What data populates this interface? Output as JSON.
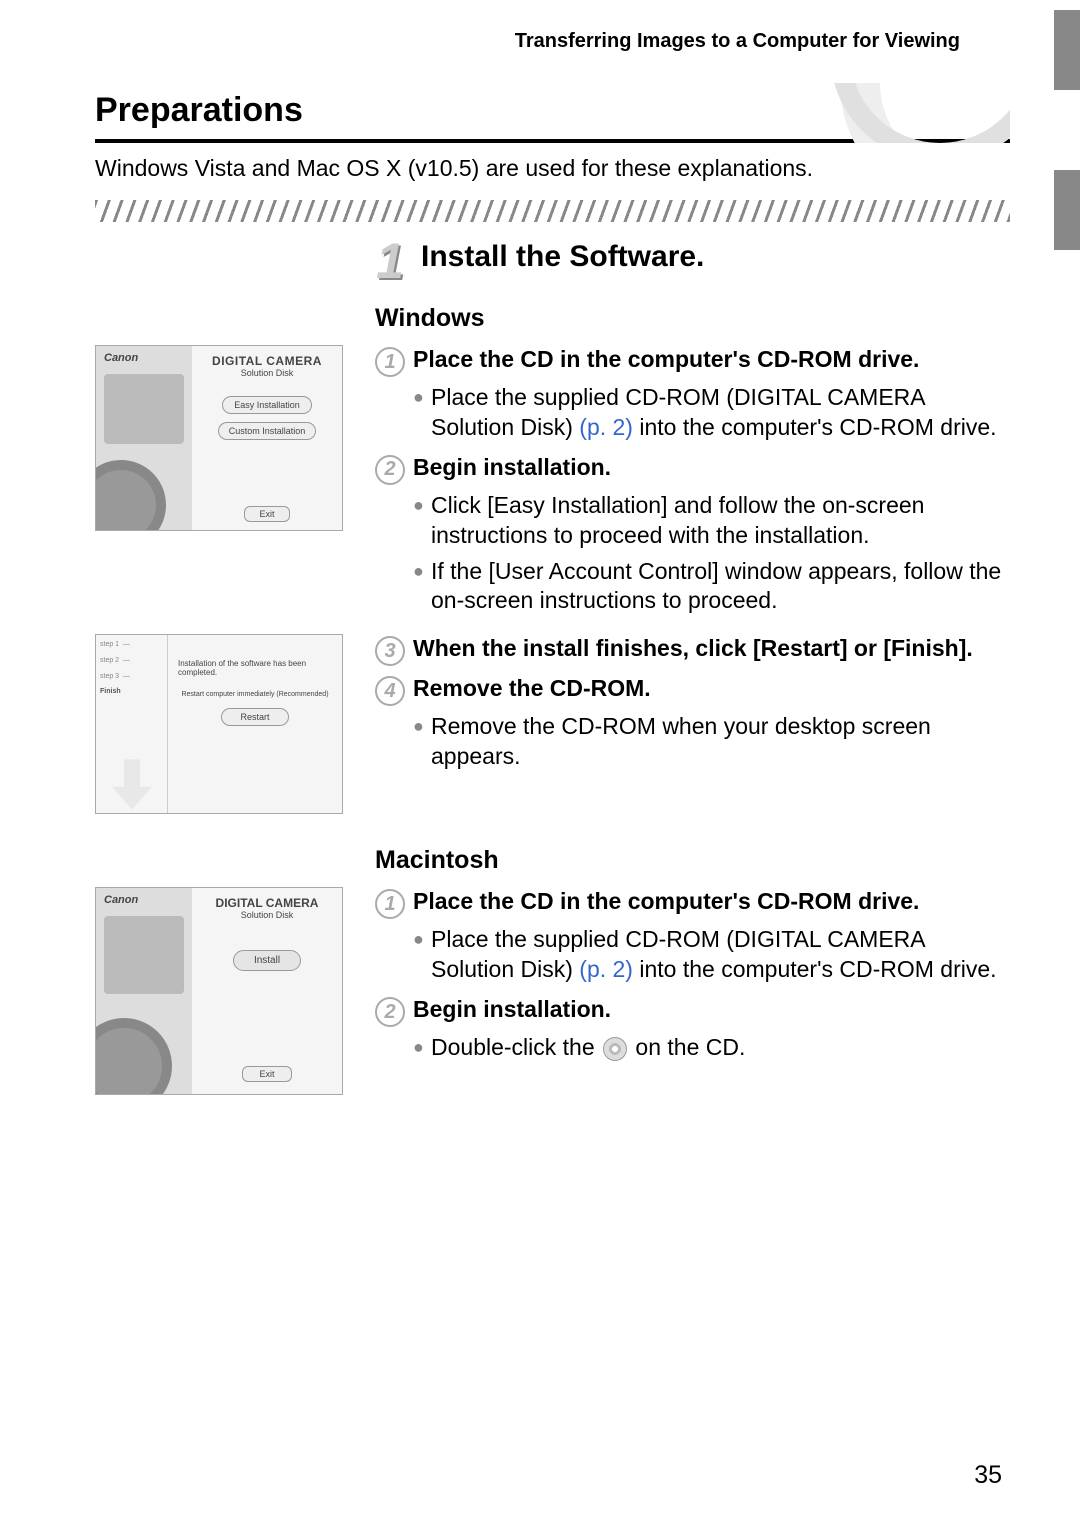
{
  "header": "Transferring Images to a Computer for Viewing",
  "section_title": "Preparations",
  "intro": "Windows Vista and Mac OS X (v10.5) are used for these explanations.",
  "main_step": {
    "num": "1",
    "title": "Install the Software."
  },
  "windows": {
    "heading": "Windows",
    "steps": [
      {
        "num": "1",
        "title": "Place the CD in the computer's CD-ROM drive.",
        "bullets": [
          {
            "pre": "Place the supplied CD-ROM (DIGITAL CAMERA Solution Disk) ",
            "ref": "(p. 2)",
            "post": " into the computer's CD-ROM drive."
          }
        ]
      },
      {
        "num": "2",
        "title": "Begin installation.",
        "bullets": [
          {
            "pre": "Click [Easy Installation] and follow the on-screen instructions to proceed with the installation.",
            "ref": "",
            "post": ""
          },
          {
            "pre": "If the [User Account Control] window appears, follow the on-screen instructions to proceed.",
            "ref": "",
            "post": ""
          }
        ]
      },
      {
        "num": "3",
        "title": "When the install finishes, click [Restart] or [Finish].",
        "bullets": []
      },
      {
        "num": "4",
        "title": "Remove the CD-ROM.",
        "bullets": [
          {
            "pre": "Remove the CD-ROM when your desktop screen appears.",
            "ref": "",
            "post": ""
          }
        ]
      }
    ]
  },
  "mac": {
    "heading": "Macintosh",
    "steps": [
      {
        "num": "1",
        "title": "Place the CD in the computer's CD-ROM drive.",
        "bullets": [
          {
            "pre": "Place the supplied CD-ROM (DIGITAL CAMERA Solution Disk) ",
            "ref": "(p. 2)",
            "post": " into the computer's CD-ROM drive."
          }
        ]
      },
      {
        "num": "2",
        "title": "Begin installation.",
        "bullets": [
          {
            "pre": "Double-click the ",
            "icon": true,
            "post": " on the CD."
          }
        ]
      }
    ]
  },
  "thumbs": {
    "win1": {
      "brand": "Canon",
      "title1": "DIGITAL CAMERA",
      "title2": "Solution Disk",
      "btn1": "Easy Installation",
      "btn2": "Custom Installation",
      "exit": "Exit"
    },
    "win2": {
      "msg": "Installation of the software has been completed.",
      "msg2": "Restart computer immediately (Recommended)",
      "btn": "Restart",
      "finish": "Finish"
    },
    "mac1": {
      "brand": "Canon",
      "title1": "DIGITAL CAMERA",
      "title2": "Solution Disk",
      "btn1": "Install",
      "exit": "Exit"
    }
  },
  "page_number": "35"
}
